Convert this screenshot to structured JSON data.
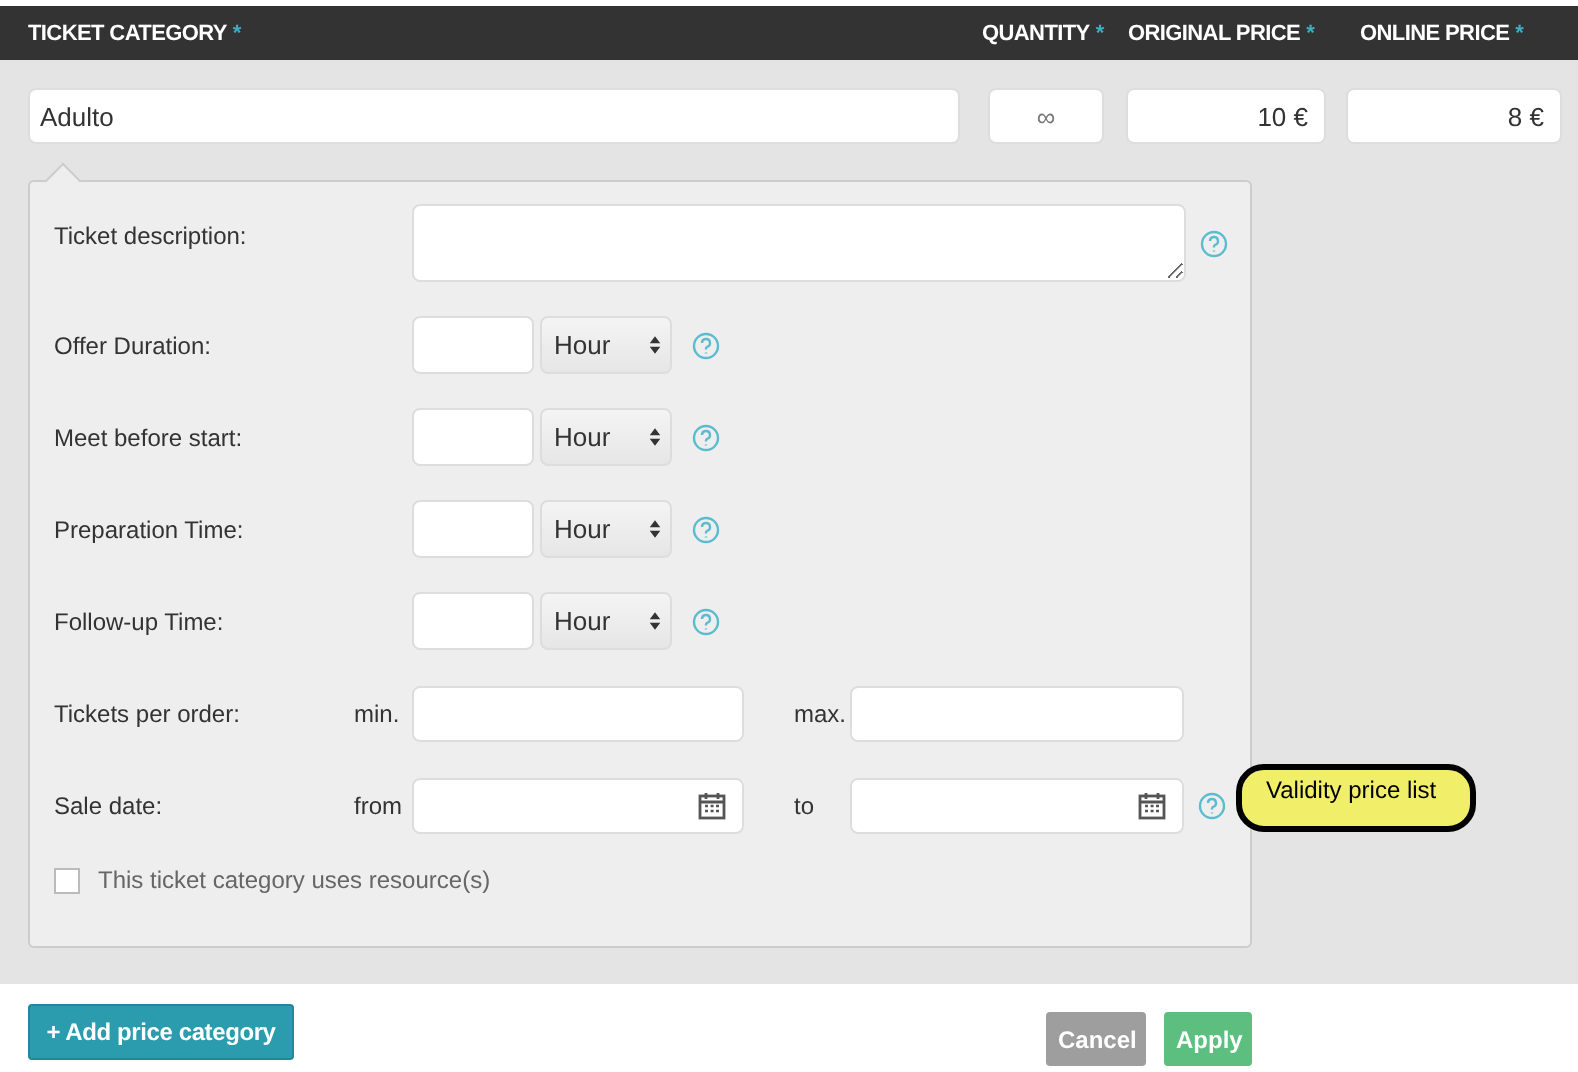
{
  "header": {
    "columns": [
      {
        "label": "TICKET CATEGORY",
        "required_mark": "*"
      },
      {
        "label": "QUANTITY",
        "required_mark": "*"
      },
      {
        "label": "ORIGINAL PRICE",
        "required_mark": "*"
      },
      {
        "label": "ONLINE PRICE",
        "required_mark": "*"
      }
    ]
  },
  "category_row": {
    "name": "Adulto",
    "quantity": "∞",
    "original_price": "10 €",
    "online_price": "8 €"
  },
  "details": {
    "description": {
      "label": "Ticket description:",
      "help": true
    },
    "durations": [
      {
        "label": "Offer Duration:",
        "unit": "Hour",
        "help": true
      },
      {
        "label": "Meet before start:",
        "unit": "Hour",
        "help": true
      },
      {
        "label": "Preparation Time:",
        "unit": "Hour",
        "help": true
      },
      {
        "label": "Follow-up Time:",
        "unit": "Hour",
        "help": true
      }
    ],
    "tickets_per_order": {
      "label": "Tickets per order:",
      "min_label": "min.",
      "max_label": "max."
    },
    "sale_date": {
      "label": "Sale date:",
      "from_label": "from",
      "to_label": "to",
      "help": true
    },
    "resource": {
      "label": "This ticket category uses resource(s)",
      "checked": false
    }
  },
  "callout": "Validity price list",
  "add_button": "+ Add price category",
  "buttons": [
    {
      "label": "Cancel",
      "kind": "cancel"
    },
    {
      "label": "Apply",
      "kind": "apply"
    }
  ]
}
